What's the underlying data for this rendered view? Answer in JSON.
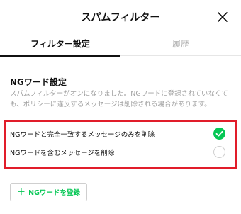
{
  "header": {
    "title": "スパムフィルター",
    "close_icon": "close-icon"
  },
  "tabs": [
    {
      "label": "フィルター設定",
      "active": true
    },
    {
      "label": "履歴",
      "active": false
    }
  ],
  "ng_word_settings": {
    "title": "NGワード設定",
    "description": "スパムフィルターがオンになりました。NGワードに登録されていなくても、ポリシーに違反するメッセージは削除される場合があります。",
    "options": [
      {
        "label": "NGワードと完全一致するメッセージのみを削除",
        "selected": true
      },
      {
        "label": "NGワードを含むメッセージを削除",
        "selected": false
      }
    ]
  },
  "add_button": {
    "icon": "plus-icon",
    "label": "NGワードを登録"
  },
  "colors": {
    "accent": "#06c755",
    "highlight": "#e11d2a",
    "muted_text": "#a0a0a0"
  }
}
